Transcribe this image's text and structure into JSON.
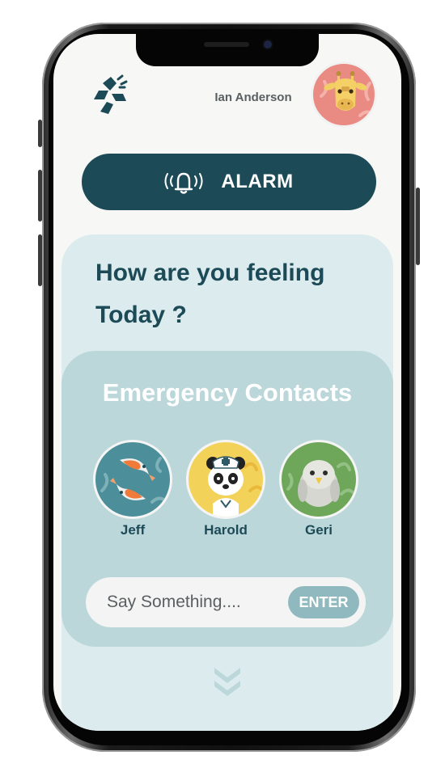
{
  "header": {
    "user_name": "Ian Anderson"
  },
  "alarm": {
    "label": "ALARM"
  },
  "prompt": {
    "line1": "How are you feeling",
    "line2": "Today ?"
  },
  "contacts": {
    "title": "Emergency Contacts",
    "people": [
      {
        "name": "Jeff",
        "icon": "koi-fish-avatar-icon",
        "color": "#4c8e99"
      },
      {
        "name": "Harold",
        "icon": "panda-nurse-avatar-icon",
        "color": "#f3d25a"
      },
      {
        "name": "Geri",
        "icon": "bird-avatar-icon",
        "color": "#6ea65a"
      }
    ]
  },
  "message": {
    "placeholder": "Say Something....",
    "enter_label": "ENTER"
  },
  "colors": {
    "primary": "#1c4a56",
    "card": "#dcecee",
    "contacts_card": "#bcd7da",
    "enter_button": "#8fb9be",
    "user_avatar": "#e98b83"
  }
}
